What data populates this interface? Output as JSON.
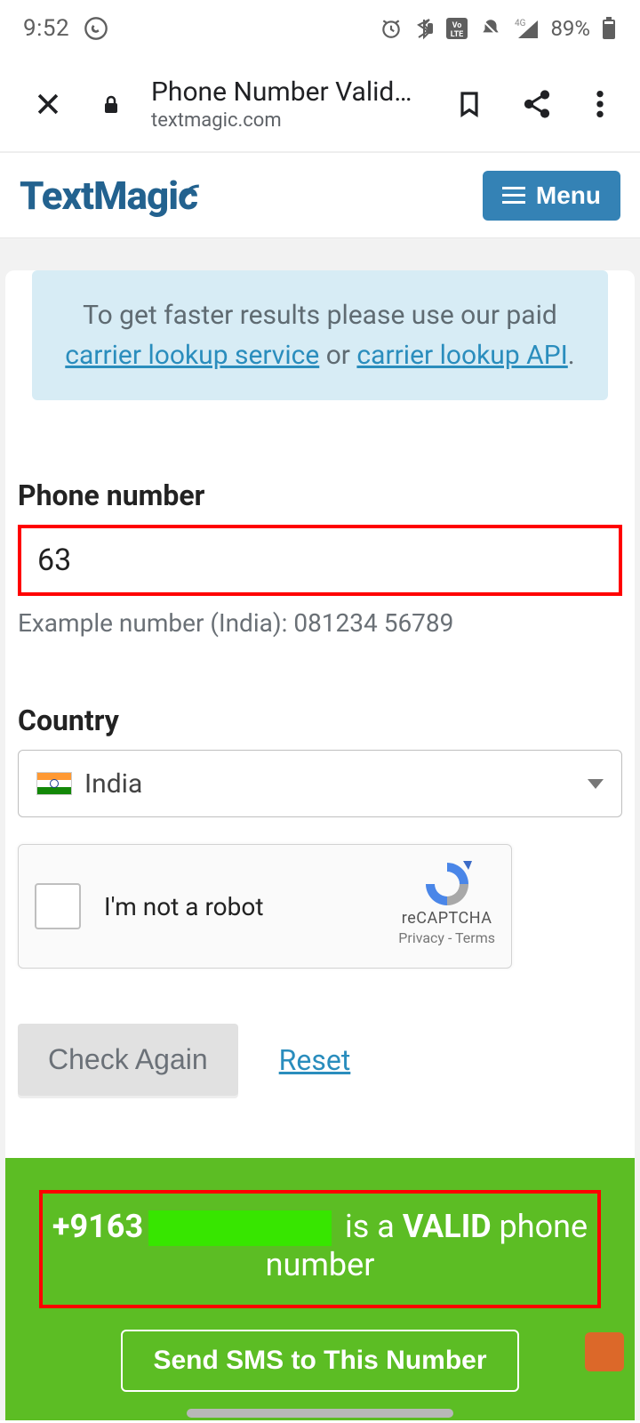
{
  "statusbar": {
    "time": "9:52",
    "battery": "89%",
    "net_label": "4G"
  },
  "chrome": {
    "page_title": "Phone Number Valid…",
    "host": "textmagic.com"
  },
  "header": {
    "brand": "TextMagic",
    "menu_label": "Menu"
  },
  "notice": {
    "pre": "To get faster results please use our paid ",
    "link1": "carrier lookup service",
    "mid": " or ",
    "link2": "carrier lookup API",
    "post": "."
  },
  "form": {
    "phone_label": "Phone number",
    "phone_value": "63",
    "phone_helper": "Example number (India): 081234 56789",
    "country_label": "Country",
    "country_value": "India"
  },
  "recaptcha": {
    "label": "I'm not a robot",
    "brand": "reCAPTCHA",
    "legal": "Privacy  -  Terms"
  },
  "actions": {
    "check": "Check Again",
    "reset": "Reset"
  },
  "result": {
    "prefix": "+9163",
    "mid_a": " is a ",
    "valid": "VALID",
    "mid_b": " phone number",
    "send": "Send SMS to This Number"
  }
}
